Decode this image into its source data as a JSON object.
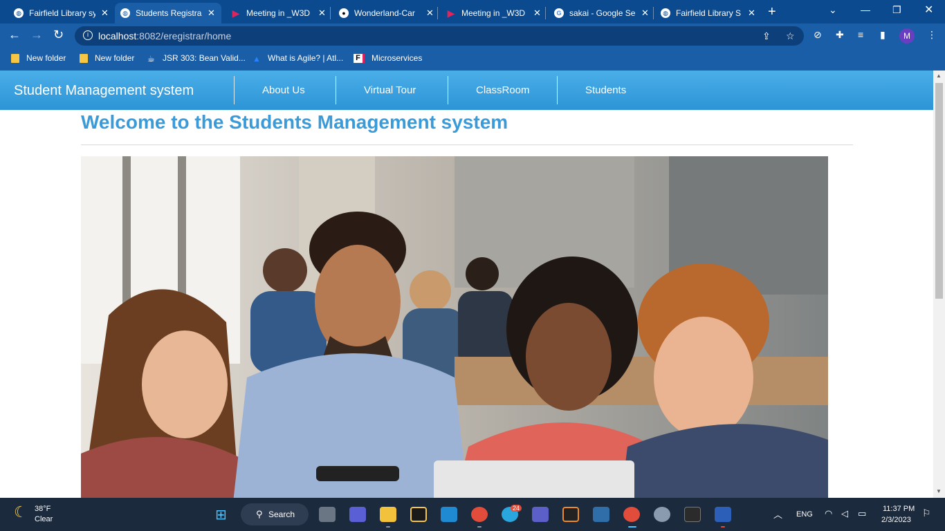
{
  "browser": {
    "tabs": [
      {
        "title": "Fairfield Library sy",
        "icon": "globe-icon",
        "active": false
      },
      {
        "title": "Students Registra",
        "icon": "globe-icon",
        "active": true
      },
      {
        "title": "Meeting in _W3D",
        "icon": "play-icon",
        "active": false
      },
      {
        "title": "Wonderland-Car",
        "icon": "github-icon",
        "active": false
      },
      {
        "title": "Meeting in _W3D",
        "icon": "play-icon",
        "active": false
      },
      {
        "title": "sakai - Google Se",
        "icon": "google-icon",
        "active": false
      },
      {
        "title": "Fairfield Library S",
        "icon": "globe-icon",
        "active": false
      }
    ],
    "url_host": "localhost",
    "url_rest": ":8082/eregistrar/home",
    "profile_initial": "M",
    "bookmarks": [
      {
        "label": "New folder",
        "icon": "folder-icon"
      },
      {
        "label": "New folder",
        "icon": "folder-icon"
      },
      {
        "label": "JSR 303: Bean Valid...",
        "icon": "bean-icon"
      },
      {
        "label": "What is Agile? | Atl...",
        "icon": "atlassian-icon"
      },
      {
        "label": "Microservices",
        "icon": "f-icon"
      }
    ]
  },
  "app": {
    "brand": "Student Management system",
    "nav": [
      "About Us",
      "Virtual Tour",
      "ClassRoom",
      "Students"
    ],
    "heading": "Welcome to the Students Management system",
    "hero_image": "students-around-laptop-photo"
  },
  "taskbar": {
    "weather_temp": "38°F",
    "weather_desc": "Clear",
    "search_label": "Search",
    "lang": "ENG",
    "time": "11:37 PM",
    "date": "2/3/2023",
    "telegram_badge": "24",
    "colors": {
      "accent": "#3b9bd8",
      "nav_bg": "#2d94d6",
      "browser_frame": "#0b4a8f"
    }
  }
}
